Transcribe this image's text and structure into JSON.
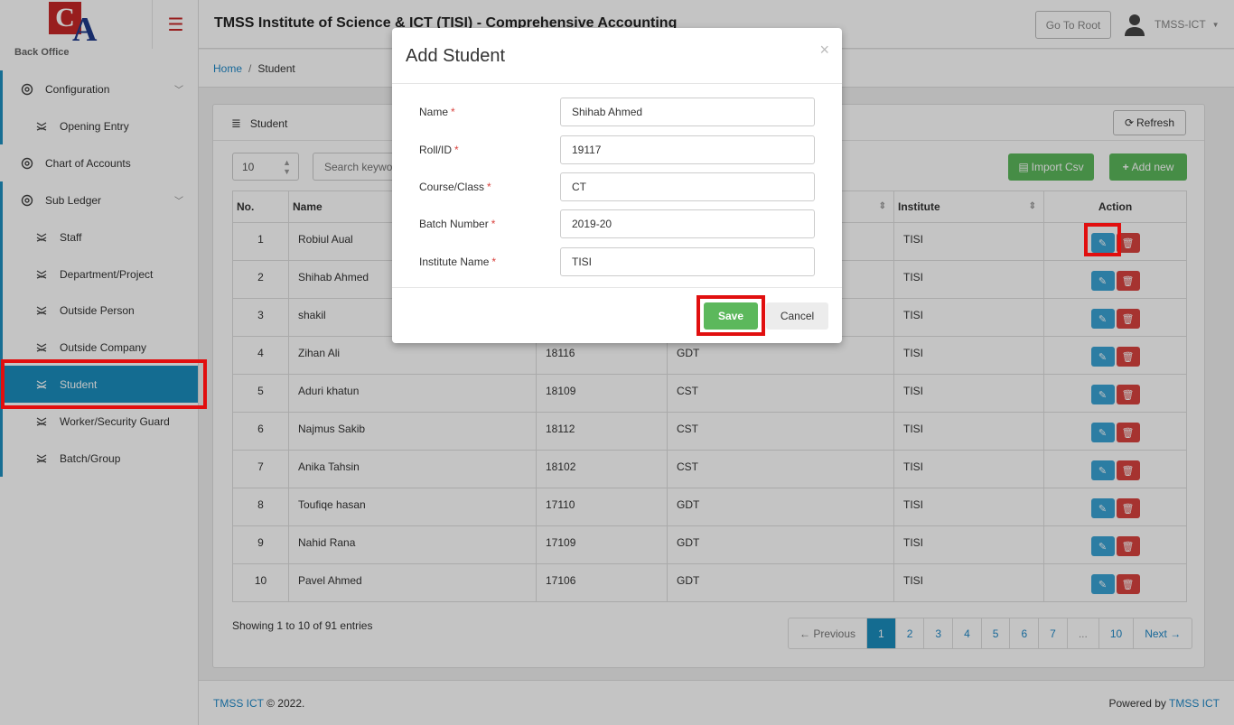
{
  "app": {
    "title": "TMSS Institute of Science & ICT (TISI) - Comprehensive Accounting",
    "logo_c": "C",
    "logo_a": "A",
    "goto_root": "Go To Root",
    "user_name": "TMSS-ICT"
  },
  "sidebar": {
    "section_title": "Back Office",
    "items": [
      {
        "label": "Configuration",
        "level": "top",
        "chevron": true
      },
      {
        "label": "Opening Entry",
        "level": "sub"
      },
      {
        "label": "Chart of Accounts",
        "level": "top"
      },
      {
        "label": "Sub Ledger",
        "level": "top",
        "chevron": true
      },
      {
        "label": "Staff",
        "level": "sub"
      },
      {
        "label": "Department/Project",
        "level": "sub"
      },
      {
        "label": "Outside Person",
        "level": "sub"
      },
      {
        "label": "Outside Company",
        "level": "sub"
      },
      {
        "label": "Student",
        "level": "sub",
        "active": true
      },
      {
        "label": "Worker/Security Guard",
        "level": "sub"
      },
      {
        "label": "Batch/Group",
        "level": "sub"
      }
    ]
  },
  "breadcrumb": {
    "home": "Home",
    "sep": "/",
    "current": "Student"
  },
  "card": {
    "title": "Student",
    "refresh": "Refresh",
    "page_length": "10",
    "search_placeholder": "Search keyword",
    "import_csv": "Import Csv",
    "add_new": "Add new",
    "columns": [
      "No.",
      "Name",
      "",
      "",
      "Institute",
      "Action"
    ],
    "rows": [
      {
        "no": "1",
        "name": "Robiul Aual",
        "roll": "",
        "course": "",
        "institute": "TISI"
      },
      {
        "no": "2",
        "name": "Shihab Ahmed",
        "roll": "",
        "course": "",
        "institute": "TISI"
      },
      {
        "no": "3",
        "name": "shakil",
        "roll": "",
        "course": "",
        "institute": "TISI"
      },
      {
        "no": "4",
        "name": "Zihan Ali",
        "roll": "18116",
        "course": "GDT",
        "institute": "TISI"
      },
      {
        "no": "5",
        "name": "Aduri khatun",
        "roll": "18109",
        "course": "CST",
        "institute": "TISI"
      },
      {
        "no": "6",
        "name": "Najmus Sakib",
        "roll": "18112",
        "course": "CST",
        "institute": "TISI"
      },
      {
        "no": "7",
        "name": "Anika Tahsin",
        "roll": "18102",
        "course": "CST",
        "institute": "TISI"
      },
      {
        "no": "8",
        "name": "Toufiqe hasan",
        "roll": "17110",
        "course": "GDT",
        "institute": "TISI"
      },
      {
        "no": "9",
        "name": "Nahid Rana",
        "roll": "17109",
        "course": "GDT",
        "institute": "TISI"
      },
      {
        "no": "10",
        "name": "Pavel Ahmed",
        "roll": "17106",
        "course": "GDT",
        "institute": "TISI"
      }
    ],
    "info": "Showing 1 to 10 of 91 entries",
    "pager": [
      "← Previous",
      "1",
      "2",
      "3",
      "4",
      "5",
      "6",
      "7",
      "...",
      "10",
      "Next →"
    ],
    "pager_active": "1"
  },
  "footer": {
    "brand": "TMSS ICT",
    "copy": " © 2022.",
    "powered": "Powered by ",
    "powered_brand": "TMSS ICT"
  },
  "modal": {
    "title": "Add Student",
    "close": "×",
    "fields": [
      {
        "label": "Name",
        "value": "Shihab Ahmed"
      },
      {
        "label": "Roll/ID",
        "value": "19117"
      },
      {
        "label": "Course/Class",
        "value": "CT"
      },
      {
        "label": "Batch Number",
        "value": "2019-20"
      },
      {
        "label": "Institute Name",
        "value": "TISI"
      }
    ],
    "required_mark": "*",
    "save": "Save",
    "cancel": "Cancel"
  },
  "colors": {
    "accent": "#1a8dbd",
    "success": "#5cb85c",
    "danger": "#d9433f",
    "highlight": "#e10f0f"
  }
}
